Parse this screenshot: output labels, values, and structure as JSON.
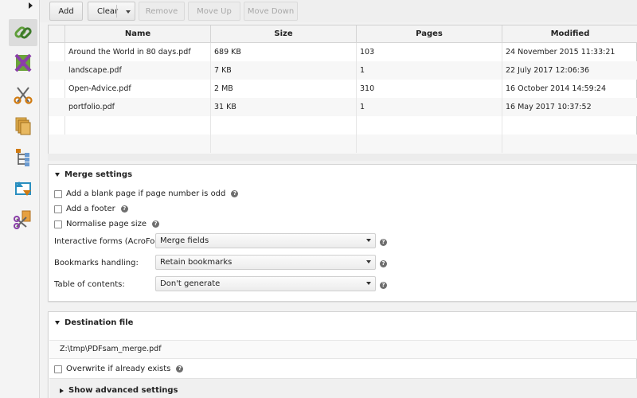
{
  "toolbar": {
    "add": "Add",
    "clear": "Clear",
    "remove": "Remove",
    "move_up": "Move Up",
    "move_down": "Move Down"
  },
  "sidebar": {
    "tools": [
      {
        "name": "merge-tool",
        "icon": "chain-links-icon",
        "active": true
      },
      {
        "name": "split-tool",
        "icon": "split-pages-icon",
        "active": false
      },
      {
        "name": "split-by-bookmarks-tool",
        "icon": "scissors-icon",
        "active": false
      },
      {
        "name": "alternate-mix-tool",
        "icon": "stacked-pages-icon",
        "active": false
      },
      {
        "name": "split-by-size-tool",
        "icon": "tree-icon",
        "active": false
      },
      {
        "name": "rotate-tool",
        "icon": "rotate-arrows-icon",
        "active": false
      },
      {
        "name": "extract-tool",
        "icon": "scissors-page-icon",
        "active": false
      }
    ]
  },
  "table": {
    "columns": [
      "Name",
      "Size",
      "Pages",
      "Modified"
    ],
    "rows": [
      {
        "name": "Around the World in 80 days.pdf",
        "size": "689 KB",
        "pages": "103",
        "modified": "24 November 2015 11:33:21"
      },
      {
        "name": "landscape.pdf",
        "size": "7 KB",
        "pages": "1",
        "modified": "22 July 2017 12:06:36"
      },
      {
        "name": "Open-Advice.pdf",
        "size": "2 MB",
        "pages": "310",
        "modified": "16 October 2014 14:59:24"
      },
      {
        "name": "portfolio.pdf",
        "size": "31 KB",
        "pages": "1",
        "modified": "16 May 2017 10:37:52"
      }
    ]
  },
  "merge": {
    "title": "Merge settings",
    "blank_page": "Add a blank page if page number is odd",
    "footer": "Add a footer",
    "normalise": "Normalise page size",
    "forms_label": "Interactive forms (AcroForms):",
    "forms_value": "Merge fields",
    "bookmarks_label": "Bookmarks handling:",
    "bookmarks_value": "Retain bookmarks",
    "toc_label": "Table of contents:",
    "toc_value": "Don't generate"
  },
  "destination": {
    "title": "Destination file",
    "path": "Z:\\tmp\\PDFsam_merge.pdf",
    "overwrite": "Overwrite if already exists",
    "advanced": "Show advanced settings"
  },
  "help_glyph": "?"
}
